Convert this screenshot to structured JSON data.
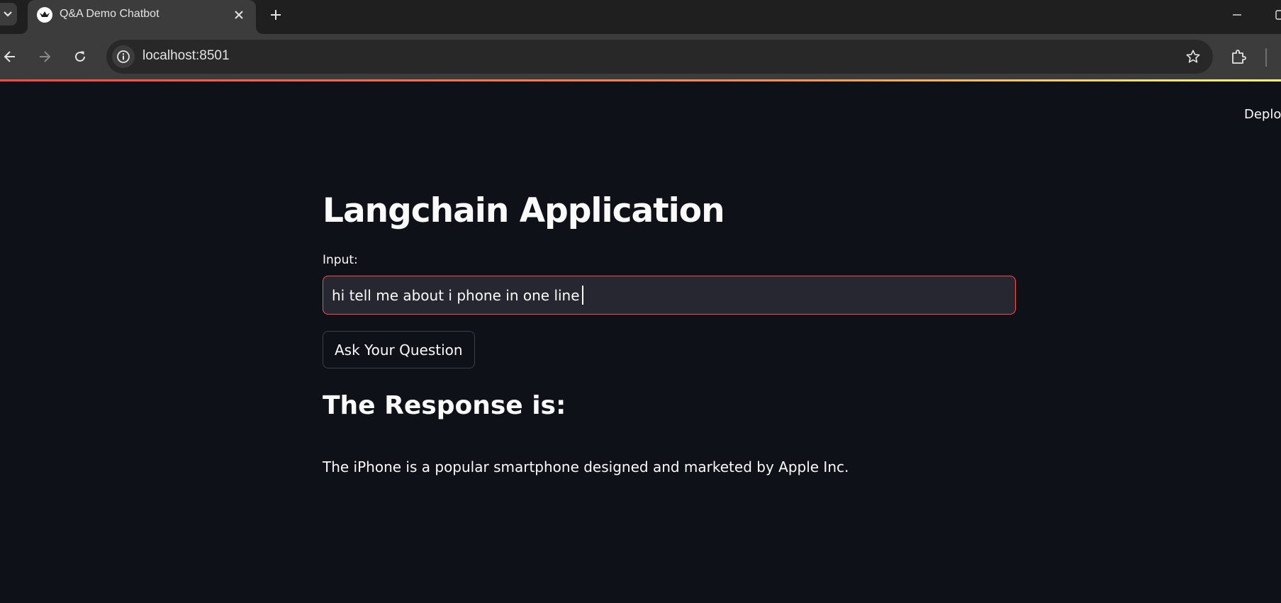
{
  "browser": {
    "tab": {
      "title": "Q&A Demo Chatbot",
      "favicon": "streamlit-crown-icon"
    },
    "address_bar": {
      "url": "localhost:8501"
    },
    "icons": {
      "tab_list": "chevron-down-icon",
      "close_tab": "close-icon",
      "new_tab": "plus-icon",
      "back": "back-arrow-icon",
      "forward": "forward-arrow-icon",
      "reload": "reload-icon",
      "site_info": "info-icon",
      "bookmark": "star-icon",
      "extensions": "puzzle-icon",
      "minimize": "minimize-icon",
      "maximize": "maximize-icon"
    }
  },
  "app": {
    "header": {
      "deploy_label": "Deploy"
    },
    "title": "Langchain Application",
    "input": {
      "label": "Input:",
      "value": "hi tell me about i phone in one line"
    },
    "button_label": "Ask Your Question",
    "response": {
      "heading": "The Response is:",
      "text": "The iPhone is a popular smartphone designed and marketed by Apple Inc."
    }
  },
  "colors": {
    "app_background": "#0e1117",
    "accent": "#ff4b4b",
    "input_background": "#262730",
    "text": "#fafafa",
    "browser_toolbar": "#3c3c3c",
    "browser_tabbar": "#1f1f1f"
  }
}
